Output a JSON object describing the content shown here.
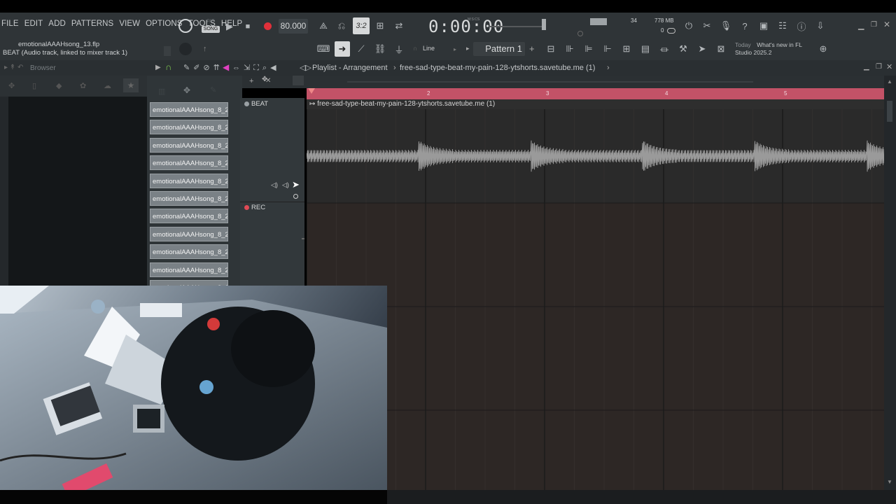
{
  "menu": [
    "FILE",
    "EDIT",
    "ADD",
    "PATTERNS",
    "VIEW",
    "OPTIONS",
    "TOOLS",
    "HELP"
  ],
  "transport": {
    "mode_top": "PAT",
    "mode_bottom": "SONG",
    "tempo": "80.000",
    "snap_display": "3:2",
    "time": "0:00:00",
    "time_label": "M:S:CS",
    "cpu": "34",
    "memory": "778 MB",
    "memory_sub": "0"
  },
  "hint": {
    "line1": "emotionalAAAHsong_13.flp",
    "line2": "BEAT (Audio track, linked to mixer track 1)"
  },
  "row2": {
    "snap_label": "Line",
    "pattern_label": "Pattern 1",
    "news_today": "Today",
    "news_line1": "What's new in FL",
    "news_line2": "Studio 2025.2"
  },
  "browser": {
    "title": "Browser"
  },
  "playlist": {
    "title": "Playlist - Arrangement",
    "breadcrumb": "free-sad-type-beat-my-pain-128-ytshorts.savetube.me (1)"
  },
  "channels": [
    "emotionalAAAHsong_8_2...",
    "emotionalAAAHsong_8_2...",
    "emotionalAAAHsong_8_2...",
    "emotionalAAAHsong_8_2...",
    "emotionalAAAHsong_8_2...",
    "emotionalAAAHsong_8_2...",
    "emotionalAAAHsong_8_2...",
    "emotionalAAAHsong_8_2...",
    "emotionalAAAHsong_8_2...",
    "emotionalAAAHsong_8_2...",
    "emotionalAAAHsong_8_2..."
  ],
  "tracks": [
    {
      "name": "BEAT",
      "color": "#9aa0a4"
    },
    {
      "name": "REC",
      "color": "#e04a55"
    }
  ],
  "ruler_bars": [
    "2",
    "3",
    "4",
    "5"
  ],
  "clip": {
    "label": "free-sad-type-beat-my-pain-128-ytshorts.savetube.me (1)"
  },
  "colors": {
    "ruler": "#c35267",
    "record": "#e0303a",
    "accent_magenta": "#e040c0",
    "accent_green": "#7ec850"
  }
}
